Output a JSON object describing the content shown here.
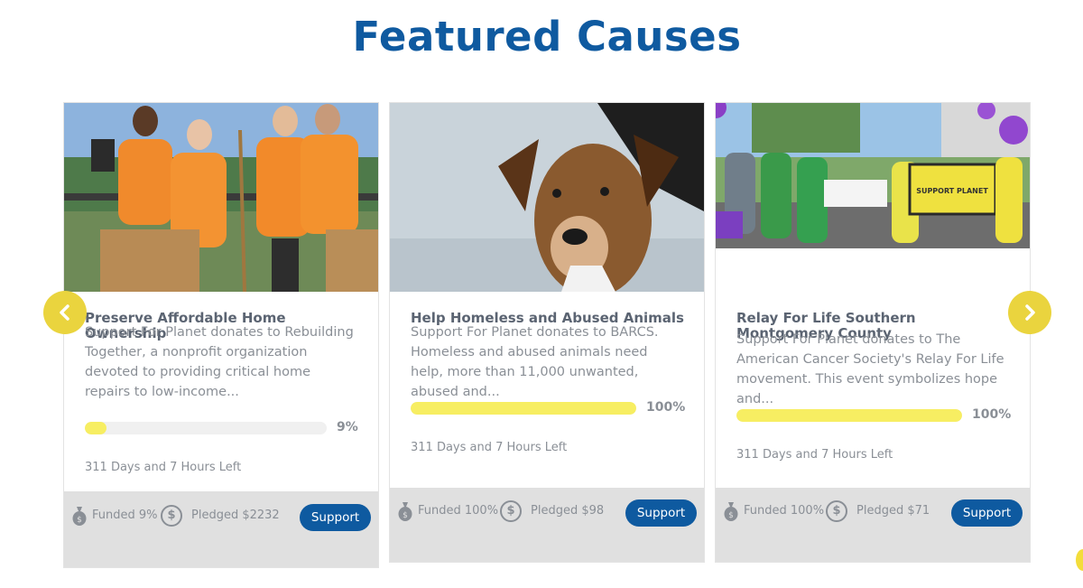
{
  "heading": "Featured Causes",
  "nav": {
    "prev_icon": "chevron-left-icon",
    "next_icon": "chevron-right-icon"
  },
  "colors": {
    "heading": "#0f5aa0",
    "progress_fill": "#f7ee62",
    "progress_track": "#f0f0f0",
    "support_button": "#0e5aa0",
    "nav_arrow": "#ead43e",
    "footer_bg": "#e0e0e0"
  },
  "causes": [
    {
      "title": "Preserve Affordable Home Ownership",
      "description": "Support For Planet donates to Rebuilding Together, a nonprofit organization devoted to providing critical home repairs to low-income...",
      "progress_percent": 9,
      "progress_label": "9%",
      "time_left": "311 Days and 7 Hours Left",
      "funded": "Funded 9%",
      "pledged": "Pledged $2232",
      "support_label": "Support"
    },
    {
      "title": "Help Homeless and Abused Animals",
      "description": "Support For Planet donates to BARCS. Homeless and abused animals need help, more than 11,000 unwanted, abused and...",
      "progress_percent": 100,
      "progress_label": "100%",
      "time_left": "311 Days and 7 Hours Left",
      "funded": "Funded 100%",
      "pledged": "Pledged $98",
      "support_label": "Support"
    },
    {
      "title": "Relay For Life Southern Montgomery County",
      "description": "Support For Planet donates to The American Cancer Society's Relay For Life movement. This event symbolizes hope and...",
      "progress_percent": 100,
      "progress_label": "100%",
      "time_left": "311 Days and 7 Hours Left",
      "funded": "Funded 100%",
      "pledged": "Pledged $71",
      "support_label": "Support",
      "banner_text": "SUPPORT PLANET"
    }
  ]
}
